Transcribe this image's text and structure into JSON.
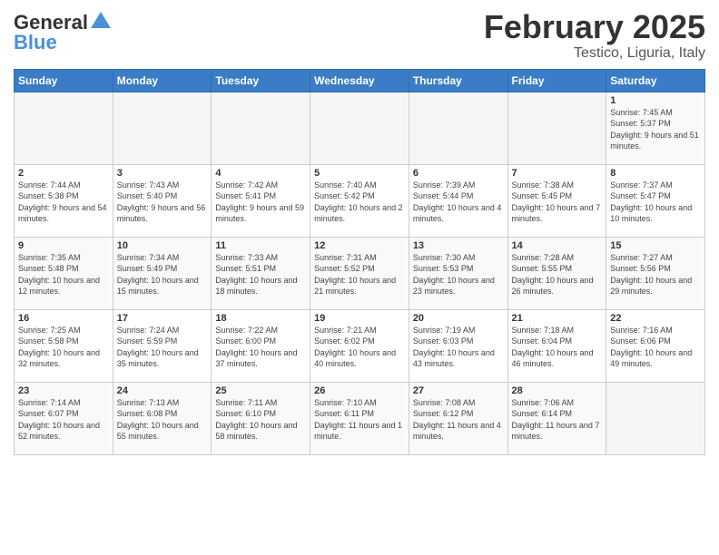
{
  "header": {
    "logo_line1": "General",
    "logo_line2": "Blue",
    "month": "February 2025",
    "location": "Testico, Liguria, Italy"
  },
  "days_of_week": [
    "Sunday",
    "Monday",
    "Tuesday",
    "Wednesday",
    "Thursday",
    "Friday",
    "Saturday"
  ],
  "weeks": [
    [
      {
        "day": "",
        "info": ""
      },
      {
        "day": "",
        "info": ""
      },
      {
        "day": "",
        "info": ""
      },
      {
        "day": "",
        "info": ""
      },
      {
        "day": "",
        "info": ""
      },
      {
        "day": "",
        "info": ""
      },
      {
        "day": "1",
        "info": "Sunrise: 7:45 AM\nSunset: 5:37 PM\nDaylight: 9 hours and 51 minutes."
      }
    ],
    [
      {
        "day": "2",
        "info": "Sunrise: 7:44 AM\nSunset: 5:38 PM\nDaylight: 9 hours and 54 minutes."
      },
      {
        "day": "3",
        "info": "Sunrise: 7:43 AM\nSunset: 5:40 PM\nDaylight: 9 hours and 56 minutes."
      },
      {
        "day": "4",
        "info": "Sunrise: 7:42 AM\nSunset: 5:41 PM\nDaylight: 9 hours and 59 minutes."
      },
      {
        "day": "5",
        "info": "Sunrise: 7:40 AM\nSunset: 5:42 PM\nDaylight: 10 hours and 2 minutes."
      },
      {
        "day": "6",
        "info": "Sunrise: 7:39 AM\nSunset: 5:44 PM\nDaylight: 10 hours and 4 minutes."
      },
      {
        "day": "7",
        "info": "Sunrise: 7:38 AM\nSunset: 5:45 PM\nDaylight: 10 hours and 7 minutes."
      },
      {
        "day": "8",
        "info": "Sunrise: 7:37 AM\nSunset: 5:47 PM\nDaylight: 10 hours and 10 minutes."
      }
    ],
    [
      {
        "day": "9",
        "info": "Sunrise: 7:35 AM\nSunset: 5:48 PM\nDaylight: 10 hours and 12 minutes."
      },
      {
        "day": "10",
        "info": "Sunrise: 7:34 AM\nSunset: 5:49 PM\nDaylight: 10 hours and 15 minutes."
      },
      {
        "day": "11",
        "info": "Sunrise: 7:33 AM\nSunset: 5:51 PM\nDaylight: 10 hours and 18 minutes."
      },
      {
        "day": "12",
        "info": "Sunrise: 7:31 AM\nSunset: 5:52 PM\nDaylight: 10 hours and 21 minutes."
      },
      {
        "day": "13",
        "info": "Sunrise: 7:30 AM\nSunset: 5:53 PM\nDaylight: 10 hours and 23 minutes."
      },
      {
        "day": "14",
        "info": "Sunrise: 7:28 AM\nSunset: 5:55 PM\nDaylight: 10 hours and 26 minutes."
      },
      {
        "day": "15",
        "info": "Sunrise: 7:27 AM\nSunset: 5:56 PM\nDaylight: 10 hours and 29 minutes."
      }
    ],
    [
      {
        "day": "16",
        "info": "Sunrise: 7:25 AM\nSunset: 5:58 PM\nDaylight: 10 hours and 32 minutes."
      },
      {
        "day": "17",
        "info": "Sunrise: 7:24 AM\nSunset: 5:59 PM\nDaylight: 10 hours and 35 minutes."
      },
      {
        "day": "18",
        "info": "Sunrise: 7:22 AM\nSunset: 6:00 PM\nDaylight: 10 hours and 37 minutes."
      },
      {
        "day": "19",
        "info": "Sunrise: 7:21 AM\nSunset: 6:02 PM\nDaylight: 10 hours and 40 minutes."
      },
      {
        "day": "20",
        "info": "Sunrise: 7:19 AM\nSunset: 6:03 PM\nDaylight: 10 hours and 43 minutes."
      },
      {
        "day": "21",
        "info": "Sunrise: 7:18 AM\nSunset: 6:04 PM\nDaylight: 10 hours and 46 minutes."
      },
      {
        "day": "22",
        "info": "Sunrise: 7:16 AM\nSunset: 6:06 PM\nDaylight: 10 hours and 49 minutes."
      }
    ],
    [
      {
        "day": "23",
        "info": "Sunrise: 7:14 AM\nSunset: 6:07 PM\nDaylight: 10 hours and 52 minutes."
      },
      {
        "day": "24",
        "info": "Sunrise: 7:13 AM\nSunset: 6:08 PM\nDaylight: 10 hours and 55 minutes."
      },
      {
        "day": "25",
        "info": "Sunrise: 7:11 AM\nSunset: 6:10 PM\nDaylight: 10 hours and 58 minutes."
      },
      {
        "day": "26",
        "info": "Sunrise: 7:10 AM\nSunset: 6:11 PM\nDaylight: 11 hours and 1 minute."
      },
      {
        "day": "27",
        "info": "Sunrise: 7:08 AM\nSunset: 6:12 PM\nDaylight: 11 hours and 4 minutes."
      },
      {
        "day": "28",
        "info": "Sunrise: 7:06 AM\nSunset: 6:14 PM\nDaylight: 11 hours and 7 minutes."
      },
      {
        "day": "",
        "info": ""
      }
    ]
  ]
}
